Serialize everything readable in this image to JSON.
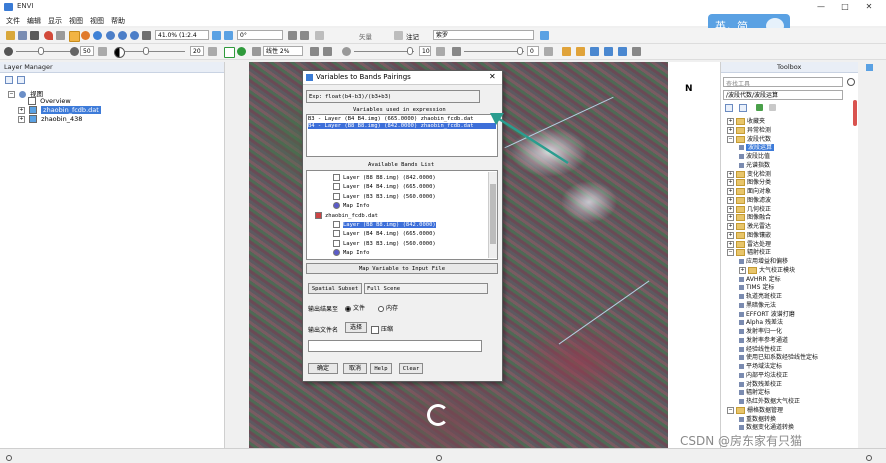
{
  "app": {
    "title": "ENVI"
  },
  "window_controls": {
    "minimize": "—",
    "maximize": "□",
    "close": "✕"
  },
  "menu": [
    "文件",
    "编辑",
    "显示",
    "视图",
    "视图",
    "帮助"
  ],
  "toolbar1": {
    "zoom_value": "41.0% (1:2.4",
    "rotation_value": "0°",
    "vector_label": "矢量",
    "annotation_label": "注记",
    "color_value": "紫罗"
  },
  "toolbar2": {
    "brightness_value": "50",
    "contrast_value": "20",
    "stretch_value": "线性 2%",
    "sharpen_value": "10",
    "transparency_value": "0"
  },
  "ime": {
    "text": "英，简"
  },
  "layer_manager": {
    "title": "Layer Manager",
    "root": "视图",
    "items": [
      {
        "label": "Overview",
        "selected": false
      },
      {
        "label": "zhaobin_fcdb.dat",
        "selected": true
      },
      {
        "label": "zhaobin_438",
        "selected": false
      }
    ]
  },
  "dialog": {
    "title": "Variables to Bands Pairings",
    "close": "✕",
    "expression_label": "Exp:",
    "expression": "float(b4-b3)/(b3+b3)",
    "variables_header": "Variables used in expression",
    "variables": [
      {
        "text": "B3 - Layer (B4 B4.img) (665.0000) zhaobin_fcdb.dat",
        "selected": false
      },
      {
        "text": "B4 - Layer (B8 B8.img) (842.0000) zhaobin_fcdb.dat",
        "selected": true
      }
    ],
    "bands_header": "Available Bands List",
    "bands": [
      {
        "text": "Layer (B8 B8.img) (842.0000)",
        "level": 2,
        "selected": false,
        "kind": "band"
      },
      {
        "text": "Layer (B4 B4.img) (665.0000)",
        "level": 2,
        "selected": false,
        "kind": "band"
      },
      {
        "text": "Layer (B3 B3.img) (560.0000)",
        "level": 2,
        "selected": false,
        "kind": "band"
      },
      {
        "text": "Map Info",
        "level": 2,
        "selected": false,
        "kind": "map"
      },
      {
        "text": "zhaobin_fcdb.dat",
        "level": 1,
        "selected": false,
        "kind": "file"
      },
      {
        "text": "Layer (B8 B8.img) (842.0000)",
        "level": 2,
        "selected": true,
        "kind": "band"
      },
      {
        "text": "Layer (B4 B4.img) (665.0000)",
        "level": 2,
        "selected": false,
        "kind": "band"
      },
      {
        "text": "Layer (B3 B3.img) (560.0000)",
        "level": 2,
        "selected": false,
        "kind": "band"
      },
      {
        "text": "Map Info",
        "level": 2,
        "selected": false,
        "kind": "map"
      }
    ],
    "map_button": "Map Variable to Input File",
    "spatial_subset_button": "Spatial Subset",
    "spatial_subset_value": "Full Scene",
    "output_to_label": "输出结果至",
    "option_file": "文件",
    "option_memory": "内存",
    "output_name_label": "输出文件名",
    "choose_button": "选择",
    "compress_label": "压缩",
    "ok_button": "确定",
    "cancel_button": "取消",
    "help_button": "Help",
    "clear_button": "Clear"
  },
  "north_arrow": "N",
  "toolbox": {
    "title": "Toolbox",
    "search_placeholder": "查找工具",
    "path": "/波段代数/波段运算",
    "items": [
      {
        "label": "收藏夹",
        "level": 0,
        "kind": "folder"
      },
      {
        "label": "异常检测",
        "level": 0,
        "kind": "folder"
      },
      {
        "label": "波段代数",
        "level": 0,
        "kind": "folder"
      },
      {
        "label": "波段运算",
        "level": 1,
        "kind": "tool",
        "selected": true
      },
      {
        "label": "波段比值",
        "level": 1,
        "kind": "tool"
      },
      {
        "label": "光谱指数",
        "level": 1,
        "kind": "tool"
      },
      {
        "label": "变化检测",
        "level": 0,
        "kind": "folder"
      },
      {
        "label": "图像分类",
        "level": 0,
        "kind": "folder"
      },
      {
        "label": "面向对象",
        "level": 0,
        "kind": "folder"
      },
      {
        "label": "图像滤波",
        "level": 0,
        "kind": "folder"
      },
      {
        "label": "几何校正",
        "level": 0,
        "kind": "folder"
      },
      {
        "label": "图像融合",
        "level": 0,
        "kind": "folder"
      },
      {
        "label": "激光雷达",
        "level": 0,
        "kind": "folder"
      },
      {
        "label": "图像镶嵌",
        "level": 0,
        "kind": "folder"
      },
      {
        "label": "雷达处理",
        "level": 0,
        "kind": "folder"
      },
      {
        "label": "辐射校正",
        "level": 0,
        "kind": "folder"
      },
      {
        "label": "应用增益和偏移",
        "level": 1,
        "kind": "tool"
      },
      {
        "label": "大气校正模块",
        "level": 1,
        "kind": "folder"
      },
      {
        "label": "AVHRR 定标",
        "level": 1,
        "kind": "tool"
      },
      {
        "label": "TIMS 定标",
        "level": 1,
        "kind": "tool"
      },
      {
        "label": "轨道亮斑校正",
        "level": 1,
        "kind": "tool"
      },
      {
        "label": "黑暗像元法",
        "level": 1,
        "kind": "tool"
      },
      {
        "label": "EFFORT 波谱打磨",
        "level": 1,
        "kind": "tool"
      },
      {
        "label": "Alpha 残差法",
        "level": 1,
        "kind": "tool"
      },
      {
        "label": "发射率归一化",
        "level": 1,
        "kind": "tool"
      },
      {
        "label": "发射率参考通道",
        "level": 1,
        "kind": "tool"
      },
      {
        "label": "经验线性校正",
        "level": 1,
        "kind": "tool"
      },
      {
        "label": "使用已知系数经验线性定标",
        "level": 1,
        "kind": "tool"
      },
      {
        "label": "平场域法定标",
        "level": 1,
        "kind": "tool"
      },
      {
        "label": "内部平均法校正",
        "level": 1,
        "kind": "tool"
      },
      {
        "label": "对数残差校正",
        "level": 1,
        "kind": "tool"
      },
      {
        "label": "辐射定标",
        "level": 1,
        "kind": "tool"
      },
      {
        "label": "热红外数据大气校正",
        "level": 1,
        "kind": "tool"
      },
      {
        "label": "栅格数据管理",
        "level": 0,
        "kind": "folder"
      },
      {
        "label": "重数据转换",
        "level": 1,
        "kind": "tool"
      },
      {
        "label": "数据变化通道转换",
        "level": 1,
        "kind": "tool"
      }
    ]
  },
  "watermark": "CSDN @房东家有只猫"
}
